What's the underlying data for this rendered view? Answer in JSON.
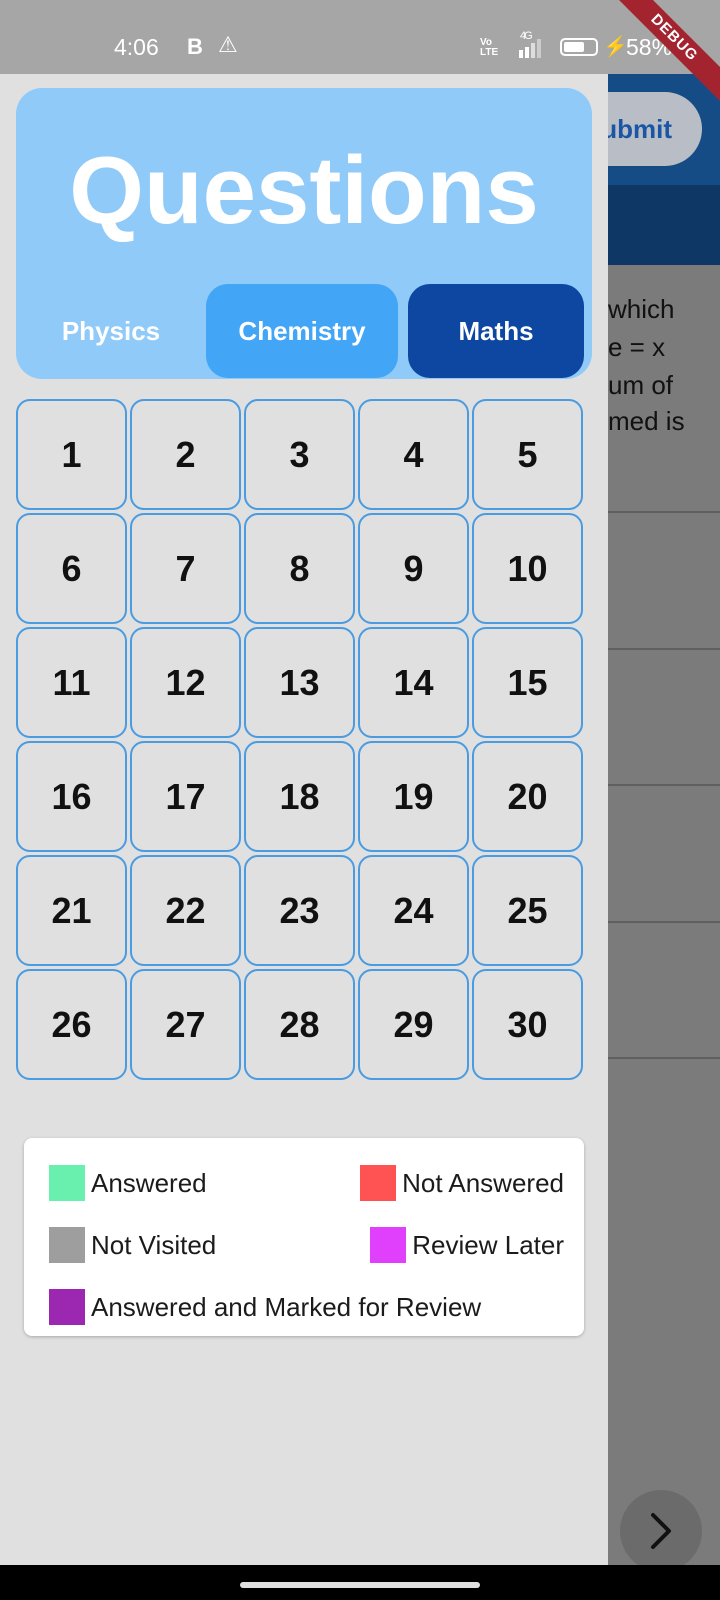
{
  "status_bar": {
    "time": "4:06",
    "b_indicator": "B",
    "warning_glyph": "⚠",
    "volte": "Vo LTE",
    "network": "4G",
    "battery_percent": "58%"
  },
  "debug_banner": "DEBUG",
  "background": {
    "submit_label": "Submit",
    "question_fragments": [
      "which",
      "e = x",
      "um of",
      "med is"
    ],
    "next_glyph": "›"
  },
  "drawer": {
    "title": "Questions",
    "tabs": [
      {
        "label": "Physics",
        "state": "inactive"
      },
      {
        "label": "Chemistry",
        "state": "normal"
      },
      {
        "label": "Maths",
        "state": "selected"
      }
    ],
    "questions": [
      "1",
      "2",
      "3",
      "4",
      "5",
      "6",
      "7",
      "8",
      "9",
      "10",
      "11",
      "12",
      "13",
      "14",
      "15",
      "16",
      "17",
      "18",
      "19",
      "20",
      "21",
      "22",
      "23",
      "24",
      "25",
      "26",
      "27",
      "28",
      "29",
      "30"
    ],
    "legend": [
      {
        "label": "Answered",
        "color": "#69f0ae"
      },
      {
        "label": "Not Answered",
        "color": "#ff5252"
      },
      {
        "label": "Not Visited",
        "color": "#9e9e9e"
      },
      {
        "label": "Review Later",
        "color": "#e040fb"
      },
      {
        "label": "Answered and Marked for Review",
        "color": "#9c27b0"
      }
    ]
  },
  "colors": {
    "header_bg": "#90caf9",
    "tab_chemistry": "#42a5f5",
    "tab_maths": "#0d47a1",
    "cell_border": "#4a9be0"
  }
}
